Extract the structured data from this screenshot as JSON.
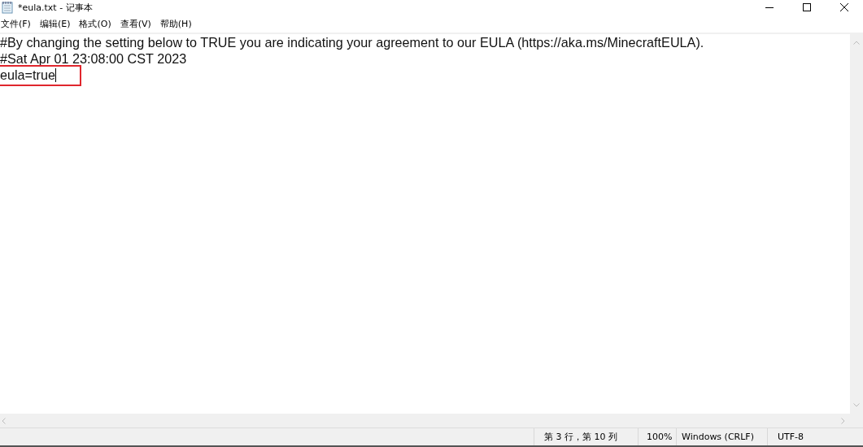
{
  "window": {
    "title": "*eula.txt - 记事本"
  },
  "menu": [
    "文件(F)",
    "编辑(E)",
    "格式(O)",
    "查看(V)",
    "帮助(H)"
  ],
  "editor": {
    "lines": [
      {
        "text": "#By changing the setting below to TRUE you are indicating your agreement to our EULA (https://aka.ms/MinecraftEULA).",
        "highlighted": false,
        "cursor": false
      },
      {
        "text": "#Sat Apr 01 23:08:00 CST 2023",
        "highlighted": false,
        "cursor": false
      },
      {
        "text": "eula=true",
        "highlighted": true,
        "cursor": true
      }
    ]
  },
  "status_bar": {
    "position": "第 3 行，第 10 列",
    "zoom": "100%",
    "line_ending": "Windows (CRLF)",
    "encoding": "UTF-8"
  }
}
